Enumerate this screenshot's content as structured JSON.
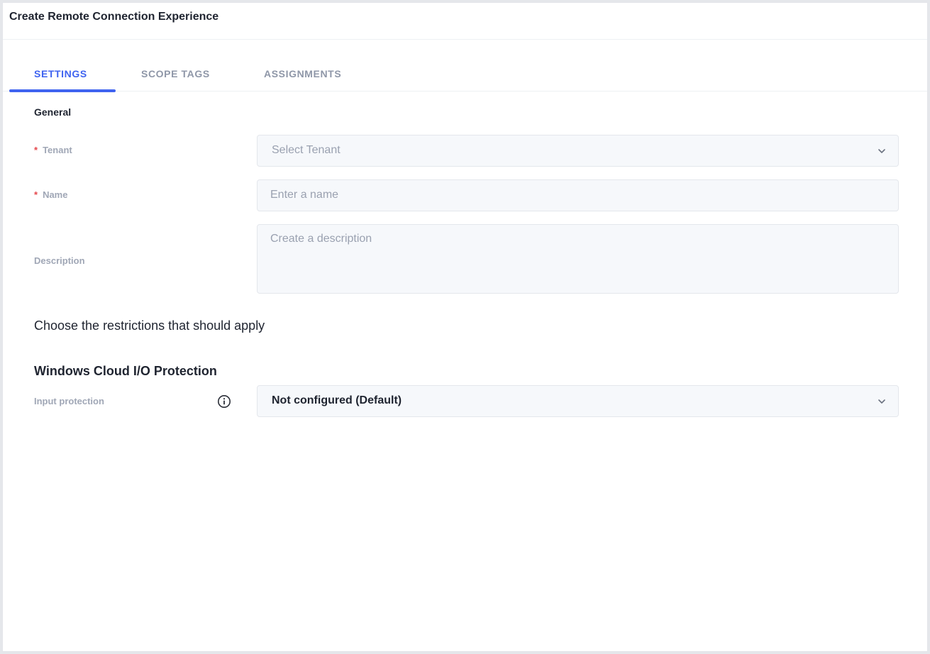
{
  "header": {
    "title": "Create Remote Connection Experience"
  },
  "tabs": [
    {
      "label": "SETTINGS",
      "active": true
    },
    {
      "label": "SCOPE TAGS",
      "active": false
    },
    {
      "label": "ASSIGNMENTS",
      "active": false
    }
  ],
  "general": {
    "title": "General",
    "tenant": {
      "required_mark": "*",
      "label": "Tenant",
      "placeholder": "Select Tenant"
    },
    "name": {
      "required_mark": "*",
      "label": "Name",
      "placeholder": "Enter a name"
    },
    "description": {
      "label": "Description",
      "placeholder": "Create a description"
    }
  },
  "restrictions": {
    "text": "Choose the restrictions that should apply"
  },
  "windows_cloud": {
    "title": "Windows Cloud I/O Protection",
    "input_protection": {
      "label": "Input protection",
      "value": "Not configured (Default)",
      "icon": "info-icon"
    }
  },
  "colors": {
    "accent": "#3f63f0",
    "required": "#e5484d",
    "muted": "#a0a7b6",
    "field_bg": "#f6f8fb"
  }
}
